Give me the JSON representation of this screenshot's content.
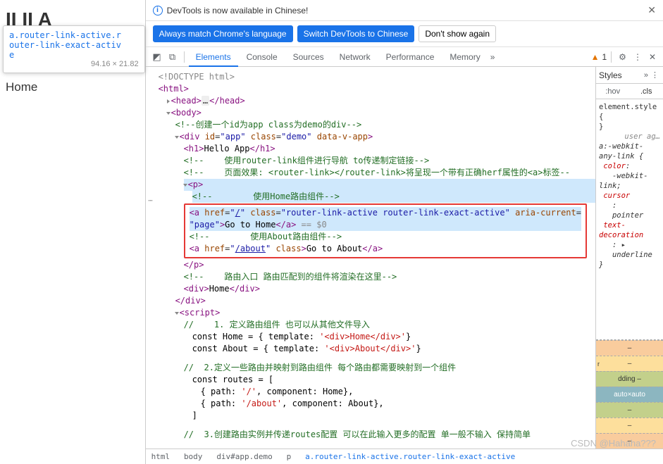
{
  "page": {
    "h1_partial": "II   II    A",
    "link_home": "Go to Home",
    "link_about": "Go to About",
    "view": "Home"
  },
  "tooltip": {
    "cls": "a.router-link-active.router-link-exact-active",
    "dim": "94.16 × 21.82"
  },
  "info": {
    "text": "DevTools is now available in Chinese!"
  },
  "buttons": {
    "b1": "Always match Chrome's language",
    "b2": "Switch DevTools to Chinese",
    "b3": "Don't show again"
  },
  "tabs": {
    "t1": "Elements",
    "t2": "Console",
    "t3": "Sources",
    "t4": "Network",
    "t5": "Performance",
    "t6": "Memory",
    "warn": "1"
  },
  "dom": {
    "l1": "<!DOCTYPE html>",
    "l2": "<html>",
    "l3a": "<head>",
    "l3b": "…",
    "l3c": "</head>",
    "l4": "<body>",
    "c1": "<!--创建一个id为app class为demo的div-->",
    "l5a": "<div id=\"",
    "l5a2": "app",
    "l5b": "\" class=\"",
    "l5b2": "demo",
    "l5c": "\" data-v-app>",
    "l6a": "<h1>",
    "l6b": "Hello App",
    "l6c": "</h1>",
    "c2a": "<!--",
    "c2b": "使用router-link组件进行导航 to传递制定链接",
    "c2c": "-->",
    "c3a": "<!--",
    "c3b": "页面效果: <router-link></router-link>将呈现一个带有正确herf属性的<a>标签",
    "c3c": "--",
    "l7": "<p>",
    "c4a": "<!--",
    "c4b": "使用Home路由组件",
    "c4c": "-->",
    "hla": "<a href=\"",
    "hlhref": "/",
    "hlb": "\" class=\"",
    "hlcls": "router-link-active router-link-exact-active",
    "hlc": "\" aria-current=",
    "hl2a": "\"",
    "hl2v": "page",
    "hl2b": "\">",
    "hl2t": "Go to Home",
    "hl2c": "</a>",
    "hl2d": " == $0",
    "c5a": "<!--",
    "c5b": "使用About路由组件",
    "c5c": "-->",
    "aba": "<a href=\"",
    "abhref": "/about",
    "abb": "\" class>",
    "abt": "Go to About",
    "abc": "</a>",
    "l8": "</p>",
    "c6a": "<!--",
    "c6b": "路由入口 路由匹配到的组件将渲染在这里",
    "c6c": "-->",
    "l9a": "<div>",
    "l9b": "Home",
    "l9c": "</div>",
    "l10": "</div>",
    "l11": "<script>",
    "s1a": "//",
    "s1b": "1. 定义路由组件 也可以从其他文件导入",
    "s2a": "const Home = { template: ",
    "s2b": "'<div>Home</div>'",
    "s2c": "}",
    "s3a": "const About = { template: ",
    "s3b": "'<div>About</div>'",
    "s3c": "}",
    "s4a": "//",
    "s4b": "2.定义一些路由并映射到路由组件 每个路由都需要映射到一个组件",
    "s5": "const routes = [",
    "s6a": "{ path: ",
    "s6b": "'/'",
    "s6c": ", component: Home},",
    "s7a": "{ path: ",
    "s7b": "'/about'",
    "s7c": ", component: About},",
    "s8": "]",
    "s9a": "//",
    "s9b": "3.创建路由实例并传递routes配置 可以在此输入更多的配置 单一般不输入 保持简单"
  },
  "styles": {
    "title": "Styles",
    "hov": ":hov",
    "cls": ".cls",
    "r1a": "element.style {",
    "r1b": "}",
    "r2hint": "user ag…",
    "r2sel": "a:-webkit-any-link {",
    "p1": "color",
    "v1": "-webkit-link",
    "p2": "cursor",
    "v2": "pointer",
    "p3": "text-decoration",
    "v3": "underline",
    "close": "}",
    "bm_dash": "–",
    "bm_pad": "dding  –",
    "bm_content": "auto×auto"
  },
  "crumbs": {
    "c1": "html",
    "c2": "body",
    "c3": "div#app.demo",
    "c4": "p",
    "c5": "a.router-link-active.router-link-exact-active"
  },
  "watermark": "CSDN @Hahaha???"
}
